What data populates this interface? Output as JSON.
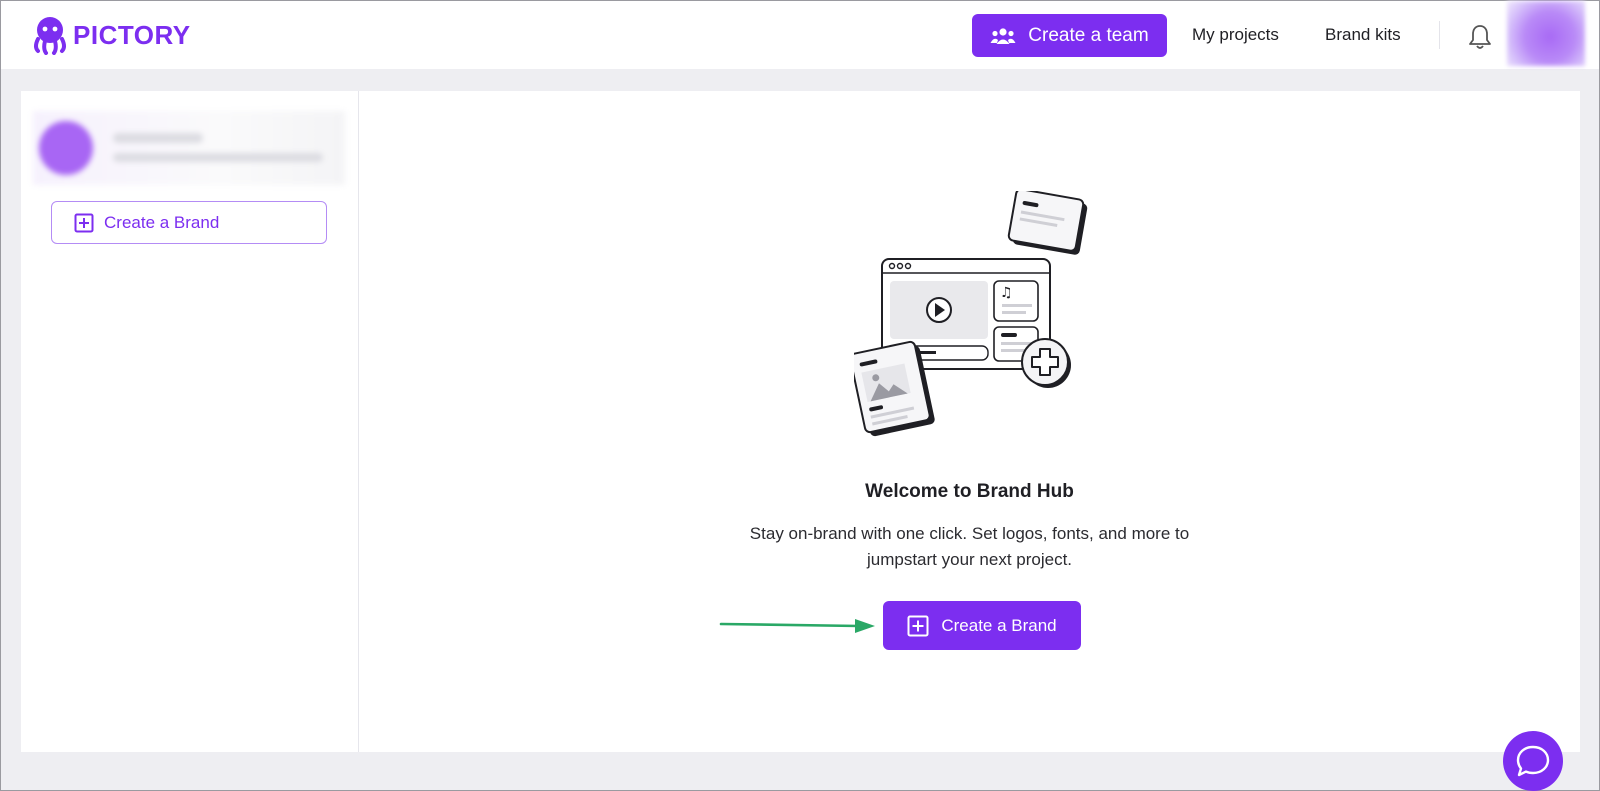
{
  "brand": {
    "logo_text": "PICTORY",
    "accent_color": "#7c2ef0",
    "logo_icon": "octopus-logo-icon"
  },
  "header": {
    "create_team_label": "Create a team",
    "create_team_icon": "team-icon",
    "nav": [
      {
        "label": "My projects"
      },
      {
        "label": "Brand kits"
      }
    ],
    "notification_icon": "bell-icon"
  },
  "sidebar": {
    "create_brand_label": "Create a Brand",
    "create_brand_icon": "plus-square-icon"
  },
  "main": {
    "title": "Welcome to Brand Hub",
    "subtitle": "Stay on-brand with one click. Set logos, fonts, and more to jumpstart your next project.",
    "create_brand_label": "Create a Brand",
    "create_brand_icon": "plus-square-icon",
    "arrow_color": "#2aa866"
  },
  "chat": {
    "icon": "chat-bubble-icon"
  }
}
